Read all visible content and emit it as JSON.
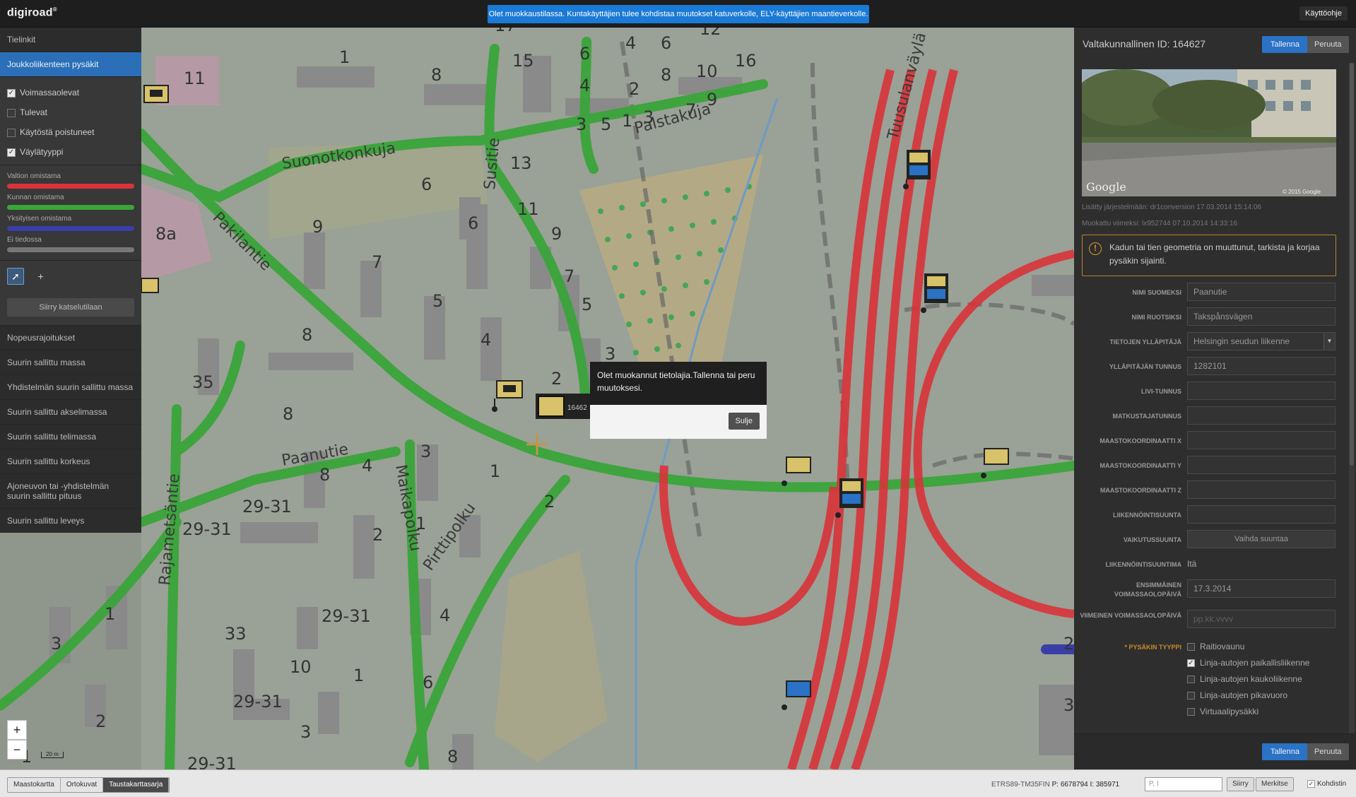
{
  "app": {
    "logo": "digiroad",
    "logo_mark": "®",
    "notice": "Olet muokkaustilassa. Kuntakäyttäjien tulee kohdistaa muutokset katuverkolle, ELY-käyttäjien maantieverkolle.",
    "help_label": "Käyttöohje"
  },
  "left_panel": {
    "tab_links": "Tielinkit",
    "tab_stops": "Joukkoliikenteen pysäkit",
    "filters": [
      {
        "label": "Voimassaolevat",
        "checked": true
      },
      {
        "label": "Tulevat",
        "checked": false
      },
      {
        "label": "Käytöstä poistuneet",
        "checked": false
      },
      {
        "label": "Väylätyyppi",
        "checked": true
      }
    ],
    "legend": [
      {
        "label": "Valtion omistama",
        "color": "#d9333a"
      },
      {
        "label": "Kunnan omistama",
        "color": "#3aa53a"
      },
      {
        "label": "Yksityisen omistama",
        "color": "#3b3ea8"
      },
      {
        "label": "Ei tiedossa",
        "color": "#777777"
      }
    ],
    "tool_select_icon": "pointer-icon",
    "tool_add_icon": "plus-icon",
    "switch_view_label": "Siirry katselutilaan",
    "layers": [
      "Nopeusrajoitukset",
      "Suurin sallittu massa",
      "Yhdistelmän suurin sallittu massa",
      "Suurin sallittu akselimassa",
      "Suurin sallittu telimassa",
      "Suurin sallittu korkeus",
      "Ajoneuvon tai -yhdistelmän suurin sallittu pituus",
      "Suurin sallittu leveys"
    ]
  },
  "map": {
    "street_names": [
      "Suonotkonkuja",
      "Palstakuja",
      "Susitie",
      "Pakilantie",
      "Paanutie",
      "Maikapolku",
      "Pirttipolku",
      "Rajametsäntie",
      "Tuusulanväylä"
    ],
    "house_numbers": [
      "11",
      "1",
      "8",
      "15",
      "6",
      "4",
      "6",
      "12",
      "17",
      "4",
      "2",
      "8",
      "10",
      "16",
      "3",
      "5",
      "1",
      "3",
      "7",
      "9",
      "13",
      "6",
      "11",
      "9",
      "6",
      "8a",
      "9",
      "7",
      "5",
      "7",
      "4",
      "5",
      "8",
      "3",
      "2",
      "35",
      "8",
      "3",
      "4",
      "8",
      "1",
      "2",
      "29-31",
      "29-31",
      "1",
      "2",
      "1",
      "29-31",
      "33",
      "10",
      "1",
      "3",
      "29-31",
      "2",
      "3",
      "4",
      "6",
      "8",
      "29-31",
      "2",
      "3",
      "1"
    ],
    "stop_label": "16462",
    "scale_label": "20 m",
    "zoom_in": "+",
    "zoom_out": "−"
  },
  "popup": {
    "message": "Olet muokannut tietolajia.Tallenna tai peru muutoksesi.",
    "close_label": "Sulje"
  },
  "right_panel": {
    "title": "Valtakunnallinen ID: 164627",
    "save_label": "Tallenna",
    "cancel_label": "Peruuta",
    "streetview_brand": "Google",
    "streetview_copy": "© 2015 Google",
    "added": "Lisätty järjestelmään: dr1conversion 17.03.2014 15:14:06",
    "modified": "Muokattu viimeksi: lx952744 07.10.2014 14:33:16",
    "warning": "Kadun tai tien geometria on muuttunut, tarkista ja korjaa pysäkin sijainti.",
    "fields": {
      "name_fi_label": "NIMI SUOMEKSI",
      "name_fi": "Paanutie",
      "name_sv_label": "NIMI RUOTSIKSI",
      "name_sv": "Takspånsvägen",
      "maintainer_label": "TIETOJEN YLLÄPITÄJÄ",
      "maintainer": "Helsingin seudun liikenne",
      "maintainer_id_label": "YLLÄPITÄJÄN TUNNUS",
      "maintainer_id": "1282101",
      "livi_label": "LIVI-TUNNUS",
      "traveler_id_label": "MATKUSTAJATUNNUS",
      "coord_x_label": "MAASTOKOORDINAATTI X",
      "coord_y_label": "MAASTOKOORDINAATTI Y",
      "coord_z_label": "MAASTOKOORDINAATTI Z",
      "direction_label": "LIIKENNÖINTISUUNTA",
      "effect_dir_label": "VAIKUTUSSUUNTA",
      "change_dir_btn": "Vaihda suuntaa",
      "dir_name_label": "LIIKENNÖINTISUUNTIMA",
      "dir_name": "Itä",
      "first_valid_label": "ENSIMMÄINEN VOIMASSAOLOPÄIVÄ",
      "first_valid": "17.3.2014",
      "last_valid_label": "VIIMEINEN VOIMASSAOLOPÄIVÄ",
      "last_valid_placeholder": "pp.kk.vvvv",
      "stop_type_label": "* PYSÄKIN TYYPPI"
    },
    "stop_types": [
      {
        "label": "Raitiovaunu",
        "checked": false
      },
      {
        "label": "Linja-autojen paikallisliikenne",
        "checked": true
      },
      {
        "label": "Linja-autojen kaukoliikenne",
        "checked": false
      },
      {
        "label": "Linja-autojen pikavuoro",
        "checked": false
      },
      {
        "label": "Virtuaalipysäkki",
        "checked": false
      }
    ]
  },
  "bottom_bar": {
    "map_types": [
      "Maastokartta",
      "Ortokuvat",
      "Taustakarttasarja"
    ],
    "active_map_type": "Taustakarttasarja",
    "crs": "ETRS89-TM35FIN",
    "p_label": "P:",
    "p_value": "6678794",
    "i_label": "I:",
    "i_value": "385971",
    "coord_placeholder": "P, I",
    "go_label": "Siirry",
    "mark_label": "Merkitse",
    "crosshair_label": "Kohdistin",
    "crosshair_checked": true
  },
  "colors": {
    "accent_blue": "#2a72c4",
    "state_road": "#d9333a",
    "municipal_road": "#3aa53a",
    "warning": "#b7872c"
  }
}
